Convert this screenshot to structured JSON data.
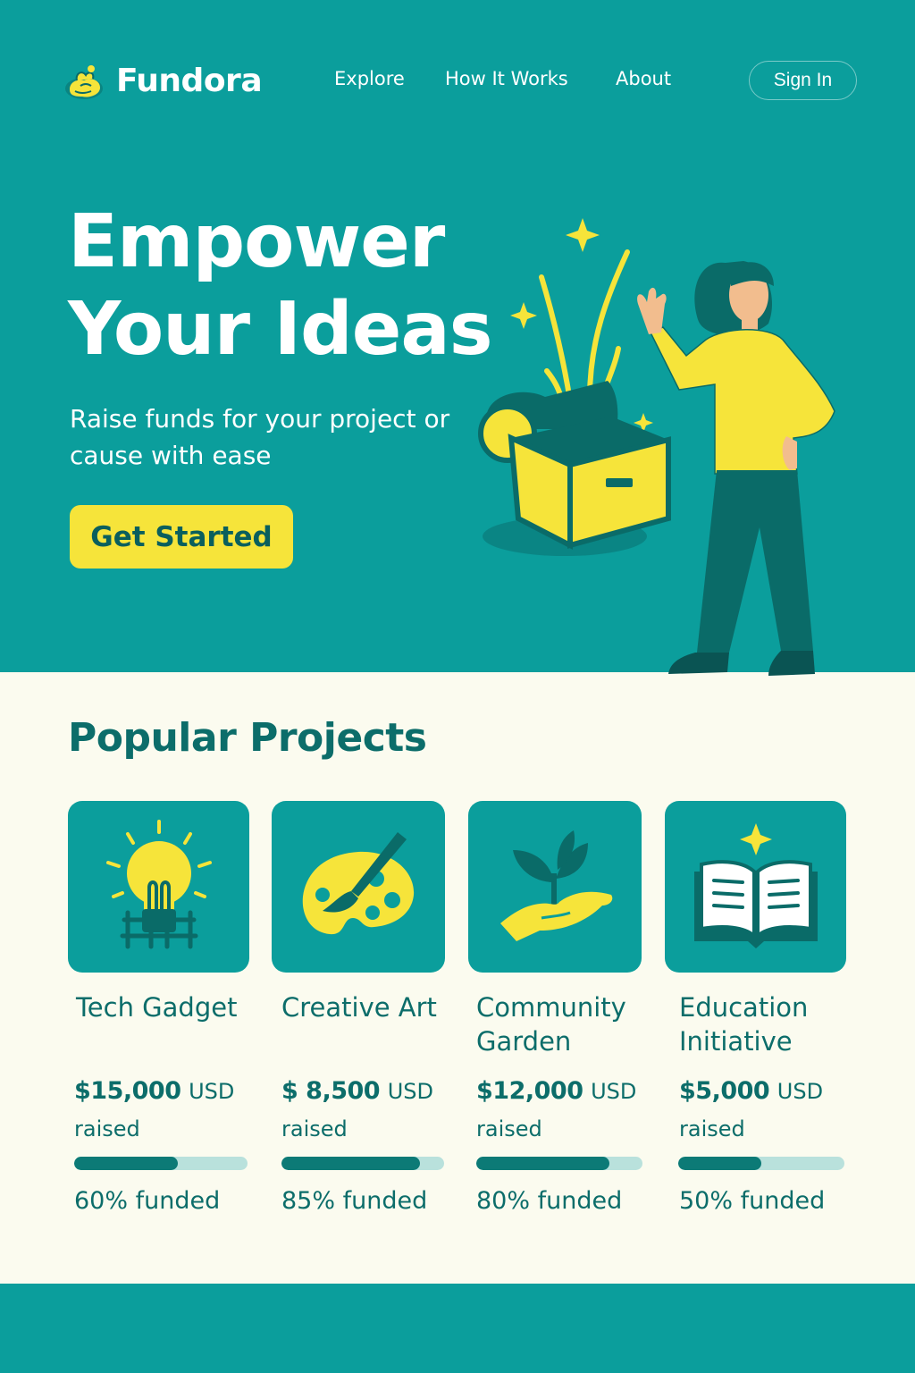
{
  "colors": {
    "teal": "#0b9e9c",
    "dark_teal": "#0c6d6a",
    "yellow": "#f6e43a",
    "cream": "#fbfbef",
    "progress_track": "#b9e1dc",
    "progress_fill": "#0c7a76"
  },
  "nav": {
    "brand": "Fundora",
    "links": [
      "Explore",
      "How It Works",
      "About"
    ],
    "sign_in": "Sign In"
  },
  "hero": {
    "title_line1": "Empower",
    "title_line2": "Your Ideas",
    "subtitle": "Raise funds for your project or cause with ease",
    "cta": "Get Started"
  },
  "projects": {
    "heading": "Popular Projects",
    "items": [
      {
        "title": "Tech Gadget",
        "amount": "$15,000",
        "currency": "USD",
        "raised_label": "raised",
        "funded_pct": 60,
        "funded_label": "60% funded",
        "icon": "lightbulb-icon"
      },
      {
        "title": "Creative Art",
        "amount": "$ 8,500",
        "currency": "USD",
        "raised_label": "raised",
        "funded_pct": 85,
        "funded_label": "85% funded",
        "icon": "palette-icon"
      },
      {
        "title": "Community Garden",
        "amount": "$12,000",
        "currency": "USD",
        "raised_label": "raised",
        "funded_pct": 80,
        "funded_label": "80% funded",
        "icon": "plant-in-hand-icon"
      },
      {
        "title": "Education Initiative",
        "amount": "$5,000",
        "currency": "USD",
        "raised_label": "raised",
        "funded_pct": 50,
        "funded_label": "50% funded",
        "icon": "open-book-icon"
      }
    ]
  }
}
